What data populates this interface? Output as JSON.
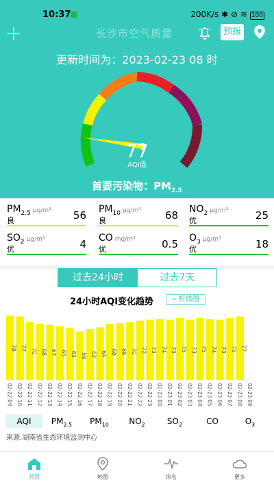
{
  "status": {
    "time": "10:37",
    "net_speed": "200K/s",
    "battery": "100"
  },
  "header": {
    "title": "长沙市空气质量",
    "forecast_label": "预报"
  },
  "summary": {
    "update_text": "更新时间为：2023-02-23 08 时",
    "aqi": "77",
    "aqi_label": "AQI值",
    "gauge_level": 0.39,
    "primary_label": "首要污染物：",
    "primary_pollutant": "PM",
    "primary_sub": "2.5"
  },
  "pollutants": [
    {
      "name": "PM",
      "sub": "2.5",
      "unit": "μg/m³",
      "grade": "良",
      "value": "56"
    },
    {
      "name": "PM",
      "sub": "10",
      "unit": "μg/m³",
      "grade": "良",
      "value": "68"
    },
    {
      "name": "NO",
      "sub": "2",
      "unit": "μg/m³",
      "grade": "优",
      "value": "25"
    },
    {
      "name": "SO",
      "sub": "2",
      "unit": "μg/m³",
      "grade": "优",
      "value": "4"
    },
    {
      "name": "CO",
      "sub": "",
      "unit": "mg/m³",
      "grade": "优",
      "value": "0.5"
    },
    {
      "name": "O",
      "sub": "3",
      "unit": "μg/m³",
      "grade": "优",
      "value": "18"
    }
  ],
  "range_tabs": [
    "过去24小时",
    "过去7天"
  ],
  "trend": {
    "title": "24小时AQI变化趋势",
    "toggle_label": "折线图"
  },
  "chart_data": {
    "type": "bar",
    "title": "24小时AQI变化趋势",
    "categories": [
      "02-22 09",
      "02-22 10",
      "02-22 11",
      "02-22 12",
      "02-22 13",
      "02-22 14",
      "02-22 15",
      "02-22 16",
      "02-22 17",
      "02-22 18",
      "02-22 19",
      "02-22 20",
      "02-22 21",
      "02-22 22",
      "02-22 23",
      "02-23 00",
      "02-23 01",
      "02-23 02",
      "02-23 03",
      "02-23 04",
      "02-23 05",
      "02-23 06",
      "02-23 07",
      "02-23 08"
    ],
    "values": [
      78,
      77,
      70,
      68,
      67,
      65,
      63,
      59,
      62,
      64,
      68,
      69,
      70,
      72,
      73,
      74,
      73,
      75,
      73,
      75,
      74,
      73,
      75,
      77
    ],
    "ylim": [
      0,
      80
    ],
    "bar_color": "#f7f200",
    "extra_axis_label": "02-23 09",
    "grid": false,
    "legend": "none"
  },
  "bottom_tabs": [
    "AQI",
    "PM",
    "PM",
    "NO",
    "SO",
    "CO",
    "O"
  ],
  "bottom_subs": [
    "",
    "2.5",
    "10",
    "2",
    "2",
    "",
    "3"
  ],
  "source": "来源:湖南省生态环境监测中心",
  "nav": [
    {
      "label": "首页",
      "icon": "home-icon"
    },
    {
      "label": "地图",
      "icon": "map-pin-icon"
    },
    {
      "label": "排名",
      "icon": "pulse-icon"
    },
    {
      "label": "更多",
      "icon": "cloud-icon"
    }
  ],
  "colors": {
    "primary": "#38c9bd",
    "good": "#f3e600",
    "excellent": "#2dbf3c"
  }
}
